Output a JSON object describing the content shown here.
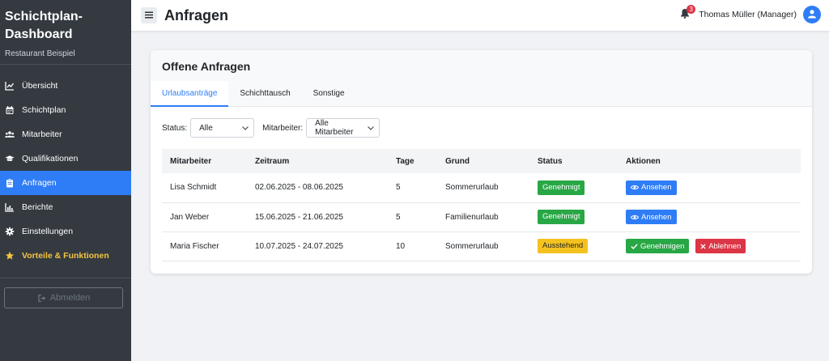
{
  "sidebar": {
    "brand_title_line1": "Schichtplan-",
    "brand_title_line2": "Dashboard",
    "brand_subtitle": "Restaurant Beispiel",
    "items": [
      {
        "label": "Übersicht",
        "icon": "chart-line-icon"
      },
      {
        "label": "Schichtplan",
        "icon": "calendar-icon"
      },
      {
        "label": "Mitarbeiter",
        "icon": "users-icon"
      },
      {
        "label": "Qualifikationen",
        "icon": "graduation-cap-icon"
      },
      {
        "label": "Anfragen",
        "icon": "clipboard-icon",
        "active": true
      },
      {
        "label": "Berichte",
        "icon": "bar-chart-icon"
      },
      {
        "label": "Einstellungen",
        "icon": "gear-icon"
      },
      {
        "label": "Vorteile & Funktionen",
        "icon": "star-icon",
        "highlight": true
      }
    ],
    "logout_label": "Abmelden"
  },
  "header": {
    "title": "Anfragen",
    "notification_count": "3",
    "user_name": "Thomas Müller (Manager)"
  },
  "card": {
    "title": "Offene Anfragen",
    "tabs": [
      {
        "label": "Urlaubsanträge",
        "active": true
      },
      {
        "label": "Schichttausch"
      },
      {
        "label": "Sonstige"
      }
    ]
  },
  "filters": {
    "status_label": "Status:",
    "status_value": "Alle",
    "employee_label": "Mitarbeiter:",
    "employee_value": "Alle Mitarbeiter"
  },
  "table": {
    "columns": [
      "Mitarbeiter",
      "Zeitraum",
      "Tage",
      "Grund",
      "Status",
      "Aktionen"
    ],
    "rows": [
      {
        "employee": "Lisa Schmidt",
        "period": "02.06.2025 - 08.06.2025",
        "days": "5",
        "reason": "Sommerurlaub",
        "status": "Genehmigt",
        "status_color": "#28a745",
        "actions": [
          "Ansehen"
        ]
      },
      {
        "employee": "Jan Weber",
        "period": "15.06.2025 - 21.06.2025",
        "days": "5",
        "reason": "Familienurlaub",
        "status": "Genehmigt",
        "status_color": "#28a745",
        "actions": [
          "Ansehen"
        ]
      },
      {
        "employee": "Maria Fischer",
        "period": "10.07.2025 - 24.07.2025",
        "days": "10",
        "reason": "Sommerurlaub",
        "status": "Ausstehend",
        "status_color": "#f4c21f",
        "actions": [
          "Genehmigen",
          "Ablehnen"
        ]
      }
    ]
  },
  "colors": {
    "sidebar_bg": "#343a40",
    "accent": "#2f7df6",
    "success": "#28a745",
    "warning": "#f4c21f",
    "danger": "#dc3545",
    "highlight": "#f5c542"
  }
}
